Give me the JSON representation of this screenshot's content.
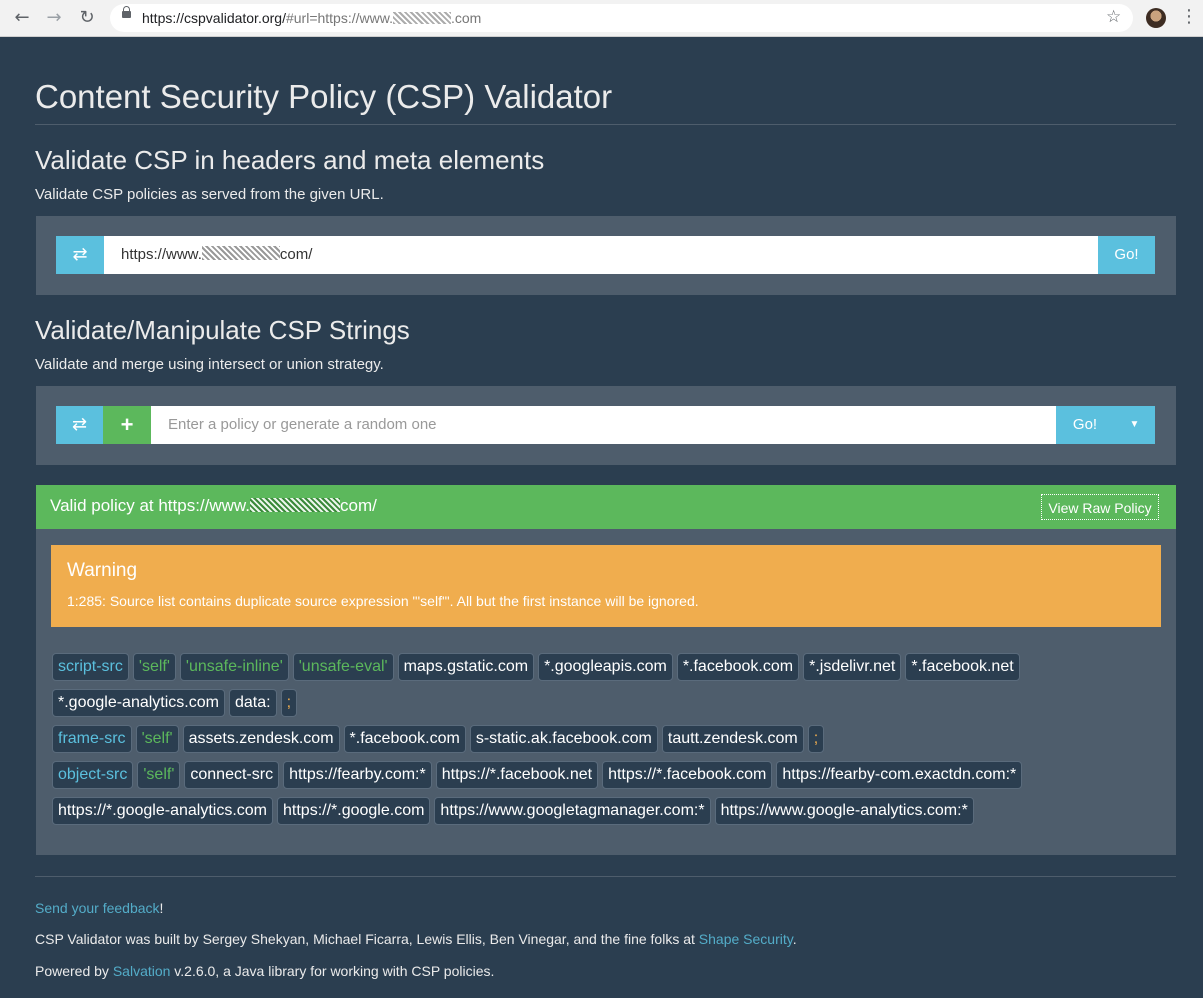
{
  "browser": {
    "url_host": "https://cspvalidator.org/",
    "url_rest_a": "#url=https://www.",
    "url_rest_b": ".com"
  },
  "page": {
    "title": "Content Security Policy (CSP) Validator"
  },
  "section1": {
    "heading": "Validate CSP in headers and meta elements",
    "subtitle": "Validate CSP policies as served from the given URL.",
    "url_prefix": "https://www.",
    "url_suffix": "com/",
    "go_label": "Go!"
  },
  "section2": {
    "heading": "Validate/Manipulate CSP Strings",
    "subtitle": "Validate and merge using intersect or union strategy.",
    "placeholder": "Enter a policy or generate a random one",
    "go_label": "Go!"
  },
  "result": {
    "title_prefix": "Valid policy at https://www.",
    "title_suffix": "com/",
    "raw_button": "View Raw Policy",
    "warning_title": "Warning",
    "warning_message": "1:285: Source list contains duplicate source expression \"'self'\". All but the first instance will be ignored.",
    "rows": [
      [
        {
          "text": "script-src",
          "kind": "dir"
        },
        {
          "text": "'self'",
          "kind": "kw"
        },
        {
          "text": "'unsafe-inline'",
          "kind": "kw"
        },
        {
          "text": "'unsafe-eval'",
          "kind": "kw"
        },
        {
          "text": "maps.gstatic.com",
          "kind": "host"
        },
        {
          "text": "*.googleapis.com",
          "kind": "host"
        },
        {
          "text": "*.facebook.com",
          "kind": "host"
        },
        {
          "text": "*.jsdelivr.net",
          "kind": "host"
        },
        {
          "text": "*.facebook.net",
          "kind": "host"
        }
      ],
      [
        {
          "text": "*.google-analytics.com",
          "kind": "host"
        },
        {
          "text": "data:",
          "kind": "host"
        },
        {
          "text": ";",
          "kind": "semi"
        }
      ],
      [
        {
          "text": "frame-src",
          "kind": "dir"
        },
        {
          "text": "'self'",
          "kind": "kw"
        },
        {
          "text": "assets.zendesk.com",
          "kind": "host"
        },
        {
          "text": "*.facebook.com",
          "kind": "host"
        },
        {
          "text": "s-static.ak.facebook.com",
          "kind": "host"
        },
        {
          "text": "tautt.zendesk.com",
          "kind": "host"
        },
        {
          "text": ";",
          "kind": "semi"
        }
      ],
      [
        {
          "text": "object-src",
          "kind": "dir"
        },
        {
          "text": "'self'",
          "kind": "kw"
        },
        {
          "text": "connect-src",
          "kind": "host"
        },
        {
          "text": "https://fearby.com:*",
          "kind": "host"
        },
        {
          "text": "https://*.facebook.net",
          "kind": "host"
        },
        {
          "text": "https://*.facebook.com",
          "kind": "host"
        },
        {
          "text": "https://fearby-com.exactdn.com:*",
          "kind": "host"
        }
      ],
      [
        {
          "text": "https://*.google-analytics.com",
          "kind": "host"
        },
        {
          "text": "https://*.google.com",
          "kind": "host"
        },
        {
          "text": "https://www.googletagmanager.com:*",
          "kind": "host"
        },
        {
          "text": "https://www.google-analytics.com:*",
          "kind": "host"
        }
      ]
    ]
  },
  "footer": {
    "feedback_link": "Send your feedback",
    "feedback_tail": "!",
    "credits_text": "CSP Validator was built by Sergey Shekyan, Michael Ficarra, Lewis Ellis, Ben Vinegar, and the fine folks at ",
    "credits_link": "Shape Security",
    "credits_tail": ".",
    "powered_prefix": "Powered by ",
    "powered_link": "Salvation",
    "powered_tail": " v.2.6.0, a Java library for working with CSP policies."
  },
  "icons": {
    "back": "back-arrow-icon",
    "forward": "forward-arrow-icon",
    "reload": "reload-icon",
    "lock": "lock-icon",
    "bookmark": "star-icon",
    "shuffle": "shuffle-icon",
    "plus": "plus-icon",
    "caret": "caret-down-icon"
  },
  "colors": {
    "background": "#2b3e50",
    "well": "#4e5d6c",
    "info": "#5bc0de",
    "success": "#5cb85c",
    "warning": "#f0ad4e"
  }
}
